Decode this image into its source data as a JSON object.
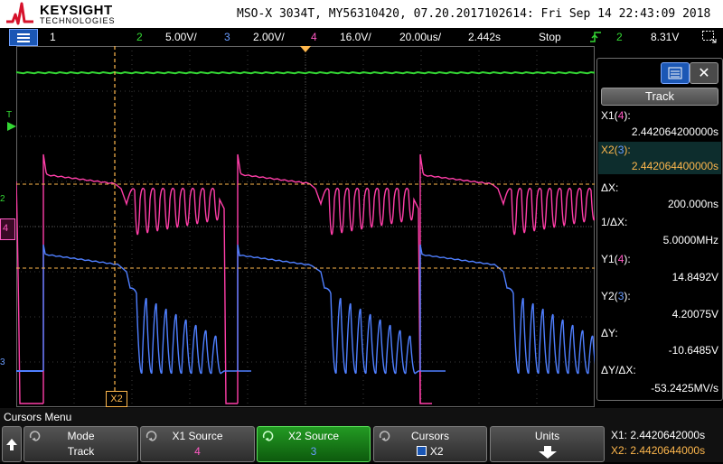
{
  "header": {
    "brand": "KEYSIGHT",
    "brand_sub": "TECHNOLOGIES",
    "title": "MSO-X 3034T, MY56310420, 07.20.2017102614: Fri Sep 14 22:43:09 2018"
  },
  "status_bar": {
    "ch1_label": "1",
    "ch2_label": "2",
    "ch2_scale": "5.00V/",
    "ch3_label": "3",
    "ch3_scale": "2.00V/",
    "ch4_label": "4",
    "ch4_scale": "16.0V/",
    "timebase": "20.00us/",
    "delay": "2.442s",
    "run_state": "Stop",
    "trigger_channel": "2",
    "trigger_level": "8.31V"
  },
  "screen_markers": {
    "trigger_marker": "T",
    "ch2_marker": "2",
    "ch4_marker": "4",
    "ch3_marker": "3",
    "x2_cursor_label": "X2"
  },
  "cursor_panel": {
    "track_label": "Track",
    "close_glyph": "✕",
    "x1_label_prefix": "X1(",
    "x1_channel": "4",
    "x1_label_suffix": "):",
    "x1_value": "2.442064200000s",
    "x2_label_prefix": "X2(",
    "x2_channel": "3",
    "x2_label_suffix": "):",
    "x2_value": "2.442064400000s",
    "dx_label": "ΔX:",
    "dx_value": "200.000ns",
    "inv_dx_label": "1/ΔX:",
    "inv_dx_value": "5.0000MHz",
    "y1_label_prefix": "Y1(",
    "y1_channel": "4",
    "y1_label_suffix": "):",
    "y1_value": "14.8492V",
    "y2_label_prefix": "Y2(",
    "y2_channel": "3",
    "y2_label_suffix": "):",
    "y2_value": "4.20075V",
    "dy_label": "ΔY:",
    "dy_value": "-10.6485V",
    "dydx_label": "ΔY/ΔX:",
    "dydx_value": "-53.2425MV/s"
  },
  "softkeys": {
    "menu_title": "Cursors Menu",
    "mode_label": "Mode",
    "mode_value": "Track",
    "x1_source_label": "X1 Source",
    "x1_source_value": "4",
    "x2_source_label": "X2 Source",
    "x2_source_value": "3",
    "cursors_label": "Cursors",
    "cursors_value": "X2",
    "units_label": "Units",
    "readout_x1": "X1: 2.4420642000s",
    "readout_x2": "X2: 2.4420644000s"
  },
  "colors": {
    "ch1": "#ffffff",
    "ch2": "#34d834",
    "ch3": "#4f7fff",
    "ch4": "#ff3ea8",
    "cursor_x1": "#ffb84d",
    "cursor_x2": "#ffb84d",
    "grid": "#3a3a3a"
  }
}
